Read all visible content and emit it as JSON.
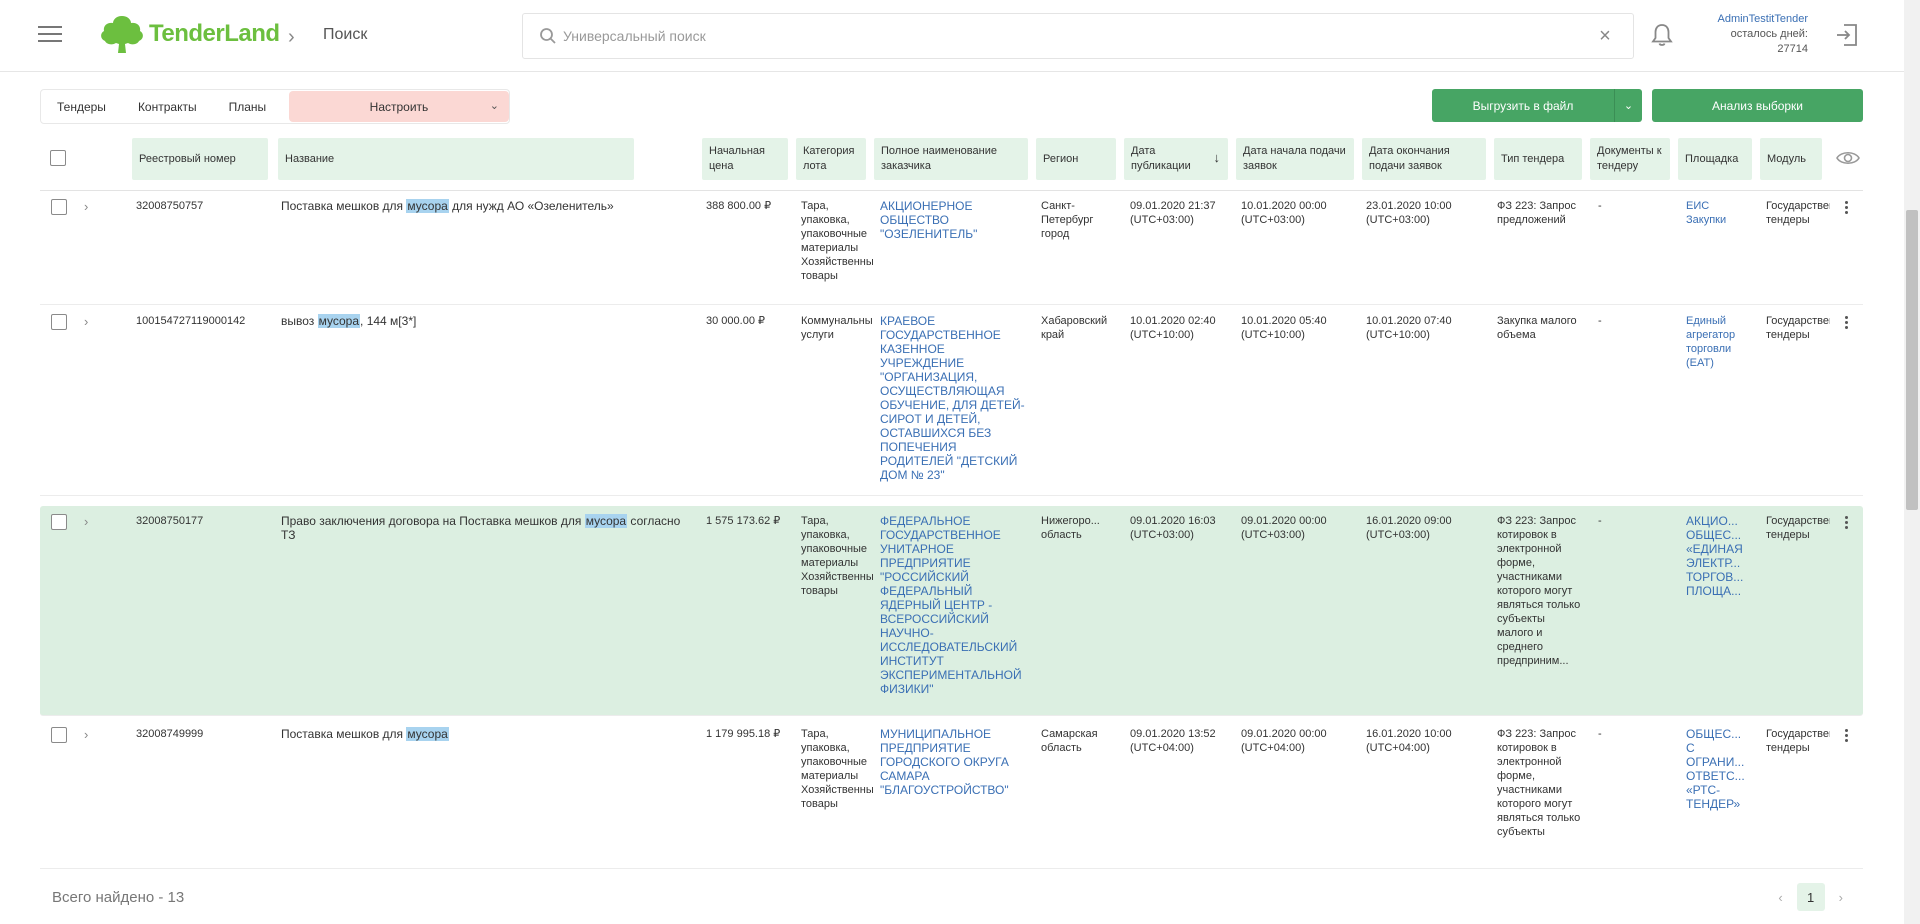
{
  "header": {
    "logo_text": "TenderLand",
    "breadcrumb": "Поиск",
    "search_placeholder": "Универсальный поиск",
    "user_name": "AdminTestitTender",
    "days_left_label": "осталось дней:",
    "days_left_value": "27714"
  },
  "toolbar": {
    "tabs": [
      "Тендеры",
      "Контракты",
      "Планы"
    ],
    "configure_label": "Настроить",
    "export_label": "Выгрузить в файл",
    "analyze_label": "Анализ выборки"
  },
  "columns": {
    "reg_number": "Реестровый номер",
    "name": "Название",
    "price": "Начальная цена",
    "category": "Категория лота",
    "customer": "Полное наименование заказчика",
    "region": "Регион",
    "pub_date": "Дата публикации",
    "start_date": "Дата начала подачи заявок",
    "end_date": "Дата окончания подачи заявок",
    "type": "Тип тендера",
    "docs": "Документы к тендеру",
    "platform": "Площадка",
    "module": "Модуль"
  },
  "rows": [
    {
      "reg": "32008750757",
      "name_before": "Поставка мешков для ",
      "name_hl": "мусора",
      "name_after": " для нужд АО «Озеленитель»",
      "price": "388 800.00 ₽",
      "category": "Тара, упаковка, упаковочные материалы Хозяйственные товары",
      "customer": "АКЦИОНЕРНОЕ ОБЩЕСТВО \"ОЗЕЛЕНИТЕЛЬ\"",
      "region": "Санкт-Петербург город",
      "pub": "09.01.2020 21:37 (UTC+03:00)",
      "start": "10.01.2020 00:00 (UTC+03:00)",
      "end": "23.01.2020 10:00 (UTC+03:00)",
      "type": "ФЗ 223: Запрос предложений",
      "docs": "-",
      "platform": "ЕИС Закупки",
      "module": "Государственные тендеры"
    },
    {
      "reg": "100154727119000142",
      "name_before": "вывоз ",
      "name_hl": "мусора",
      "name_after": ", 144 м[3*]",
      "price": "30 000.00 ₽",
      "category": "Коммунальные услуги",
      "customer": "КРАЕВОЕ ГОСУДАРСТВЕННОЕ КАЗЕННОЕ УЧРЕЖДЕНИЕ \"ОРГАНИЗАЦИЯ, ОСУЩЕСТВЛЯЮЩАЯ ОБУЧЕНИЕ, ДЛЯ ДЕТЕЙ-СИРОТ И ДЕТЕЙ, ОСТАВШИХСЯ БЕЗ ПОПЕЧЕНИЯ РОДИТЕЛЕЙ \"ДЕТСКИЙ ДОМ № 23\"",
      "region": "Хабаровский край",
      "pub": "10.01.2020 02:40 (UTC+10:00)",
      "start": "10.01.2020 05:40 (UTC+10:00)",
      "end": "10.01.2020 07:40 (UTC+10:00)",
      "type": "Закупка малого объема",
      "docs": "-",
      "platform": "Единый агрегатор торговли (ЕАТ)",
      "module": "Государственные тендеры"
    },
    {
      "reg": "32008750177",
      "name_before": "Право заключения договора на Поставка мешков для ",
      "name_hl": "мусора",
      "name_after": " согласно ТЗ",
      "price": "1 575 173.62 ₽",
      "category": "Тара, упаковка, упаковочные материалы Хозяйственные товары",
      "customer": "ФЕДЕРАЛЬНОЕ ГОСУДАРСТВЕННОЕ УНИТАРНОЕ ПРЕДПРИЯТИЕ \"РОССИЙСКИЙ ФЕДЕРАЛЬНЫЙ ЯДЕРНЫЙ ЦЕНТР - ВСЕРОССИЙСКИЙ НАУЧНО-ИССЛЕДОВАТЕЛЬСКИЙ ИНСТИТУТ ЭКСПЕРИМЕНТАЛЬНОЙ ФИЗИКИ\"",
      "region": "Нижегоро... область",
      "pub": "09.01.2020 16:03 (UTC+03:00)",
      "start": "09.01.2020 00:00 (UTC+03:00)",
      "end": "16.01.2020 09:00 (UTC+03:00)",
      "type": "ФЗ 223: Запрос котировок в электронной форме, участниками которого могут являться только субъекты малого и среднего предприним...",
      "docs": "-",
      "platform": "АКЦИО... ОБЩЕС... «ЕДИНАЯ ЭЛЕКТР... ТОРГОВ... ПЛОЩА...",
      "module": "Государственные тендеры"
    },
    {
      "reg": "32008749999",
      "name_before": "Поставка мешков для ",
      "name_hl": "мусора",
      "name_after": "",
      "price": "1 179 995.18 ₽",
      "category": "Тара, упаковка, упаковочные материалы Хозяйственные товары",
      "customer": "МУНИЦИПАЛЬНОЕ ПРЕДПРИЯТИЕ ГОРОДСКОГО ОКРУГА САМАРА \"БЛАГОУСТРОЙСТВО\"",
      "region": "Самарская область",
      "pub": "09.01.2020 13:52 (UTC+04:00)",
      "start": "09.01.2020 00:00 (UTC+04:00)",
      "end": "16.01.2020 10:00 (UTC+04:00)",
      "type": "ФЗ 223: Запрос котировок в электронной форме, участниками которого могут являться только субъекты",
      "docs": "-",
      "platform": "ОБЩЕС... С ОГРАНИ... ОТВЕТС... «РТС-ТЕНДЕР»",
      "module": "Государственные тендеры"
    }
  ],
  "footer": {
    "total": "Всего найдено - 13",
    "page": "1"
  }
}
